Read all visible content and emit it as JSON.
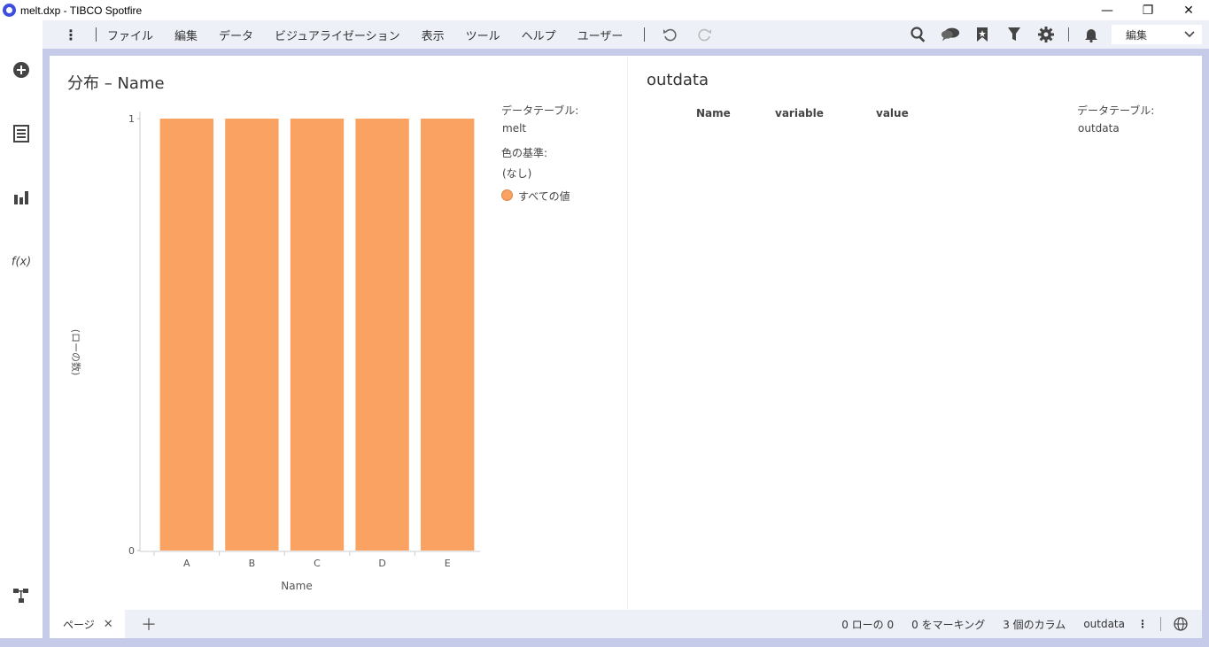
{
  "window": {
    "title": "melt.dxp - TIBCO Spotfire",
    "minimize": "—",
    "restore": "❐",
    "close": "✕"
  },
  "menu": {
    "items": [
      "ファイル",
      "編集",
      "データ",
      "ビジュアライゼーション",
      "表示",
      "ツール",
      "ヘルプ",
      "ユーザー"
    ],
    "mode_label": "編集"
  },
  "bar_viz": {
    "title": "分布 – Name",
    "legend": {
      "table_label": "データテーブル:",
      "table_value": "melt",
      "color_label": "色の基準:",
      "color_value": "(なし)",
      "item_label": "すべての値"
    }
  },
  "table_viz": {
    "title": "outdata",
    "columns": [
      "Name",
      "variable",
      "value"
    ],
    "legend": {
      "table_label": "データテーブル:",
      "table_value": "outdata"
    }
  },
  "status": {
    "page_tab": "ページ",
    "rows": "0 ローの 0",
    "marked": "0 をマーキング",
    "columns": "3 個のカラム",
    "table": "outdata"
  },
  "colors": {
    "bar": "#faa261",
    "accent": "#3d4de0"
  },
  "chart_data": {
    "type": "bar",
    "categories": [
      "A",
      "B",
      "C",
      "D",
      "E"
    ],
    "values": [
      1,
      1,
      1,
      1,
      1
    ],
    "title": "",
    "xlabel": "Name",
    "ylabel": "(ローの数)",
    "ylim": [
      0,
      1
    ],
    "yticks": [
      "0",
      "1"
    ],
    "grid": false
  }
}
